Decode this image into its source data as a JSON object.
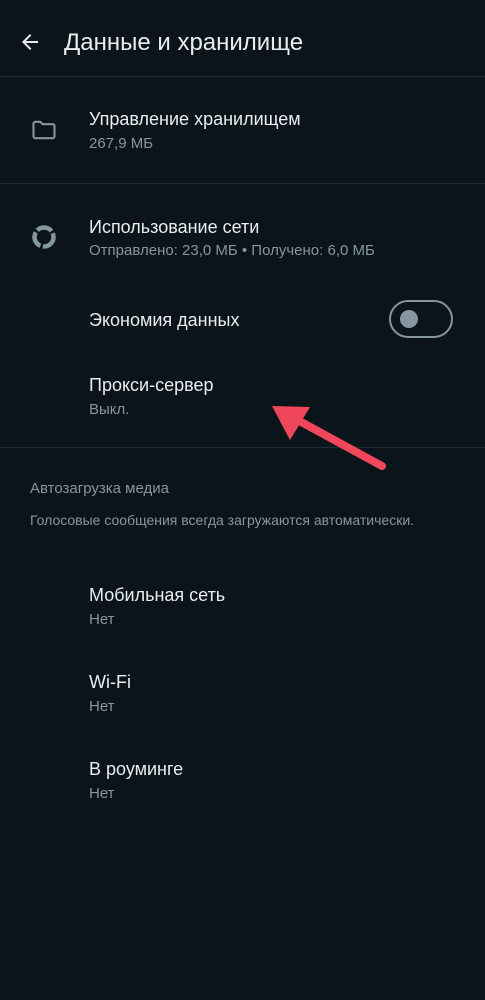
{
  "header": {
    "title": "Данные и хранилище",
    "back_icon": "arrow-left-icon"
  },
  "storage": {
    "title": "Управление хранилищем",
    "size": "267,9 МБ",
    "icon": "folder-icon"
  },
  "network_usage": {
    "title": "Использование сети",
    "summary": "Отправлено: 23,0 МБ • Получено: 6,0 МБ",
    "icon": "donut-chart-icon"
  },
  "data_saver": {
    "title": "Экономия данных",
    "enabled": false
  },
  "proxy": {
    "title": "Прокси-сервер",
    "status": "Выкл."
  },
  "media_autodownload": {
    "header": "Автозагрузка медиа",
    "note": "Голосовые сообщения всегда загружаются автоматически.",
    "items": [
      {
        "title": "Мобильная сеть",
        "value": "Нет"
      },
      {
        "title": "Wi-Fi",
        "value": "Нет"
      },
      {
        "title": "В роуминге",
        "value": "Нет"
      }
    ]
  },
  "colors": {
    "background": "#0b141a",
    "primary_text": "#e9edef",
    "secondary_text": "#8696a0",
    "divider": "#1f2c34",
    "annotation_arrow": "#f0485a"
  }
}
